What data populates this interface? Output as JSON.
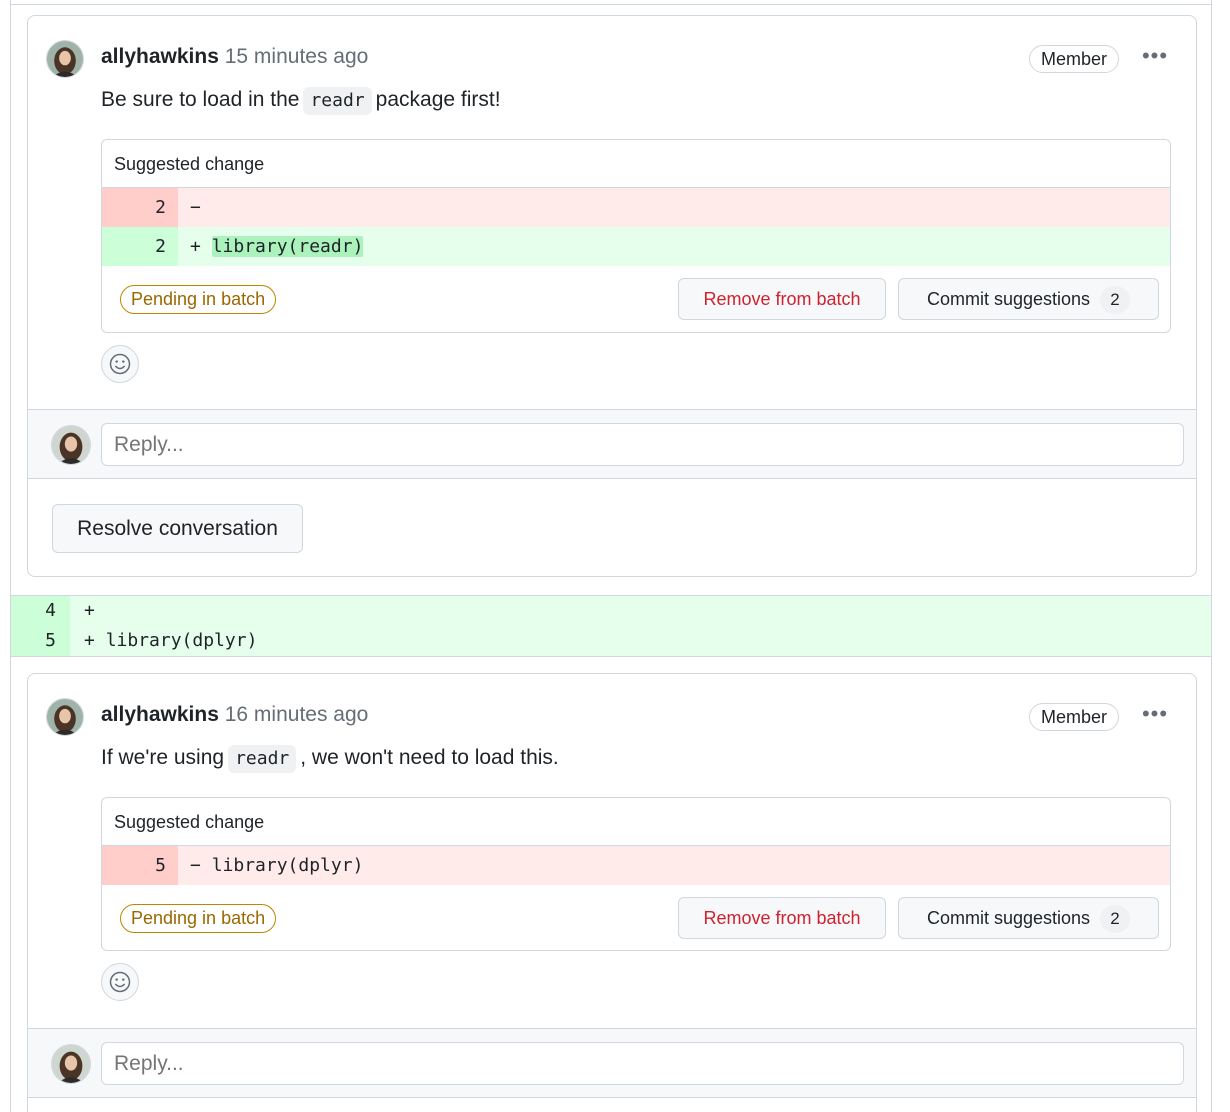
{
  "threads": [
    {
      "author": "allyhawkins",
      "time": "15 minutes ago",
      "badge": "Member",
      "more_icon": "kebab-horizontal-icon",
      "body_before": "Be sure to load in the",
      "body_code": "readr",
      "body_after": "package first!",
      "suggestion": {
        "title": "Suggested change",
        "rows": [
          {
            "type": "del",
            "num": "2",
            "sign": "−",
            "code": ""
          },
          {
            "type": "add",
            "num": "2",
            "sign": "+",
            "code": "library(readr)"
          }
        ],
        "pending_label": "Pending in batch",
        "remove_label": "Remove from batch",
        "commit_label": "Commit suggestions",
        "commit_count": "2"
      },
      "reply_placeholder": "Reply...",
      "resolve_label": "Resolve conversation"
    },
    {
      "author": "allyhawkins",
      "time": "16 minutes ago",
      "badge": "Member",
      "more_icon": "kebab-horizontal-icon",
      "body_before": "If we're using",
      "body_code": "readr",
      "body_after": ", we won't need to load this.",
      "suggestion": {
        "title": "Suggested change",
        "rows": [
          {
            "type": "del",
            "num": "5",
            "sign": "−",
            "code": "library(dplyr)"
          }
        ],
        "pending_label": "Pending in batch",
        "remove_label": "Remove from batch",
        "commit_label": "Commit suggestions",
        "commit_count": "2"
      },
      "reply_placeholder": "Reply..."
    }
  ],
  "diff_lines": [
    {
      "num": "4",
      "sign": "+",
      "code": ""
    },
    {
      "num": "5",
      "sign": "+",
      "code": "library(dplyr)"
    }
  ],
  "colors": {
    "added_bg": "#e6ffec",
    "removed_bg": "#ffebe9",
    "danger": "#cf222e",
    "attention": "#9a6700"
  }
}
